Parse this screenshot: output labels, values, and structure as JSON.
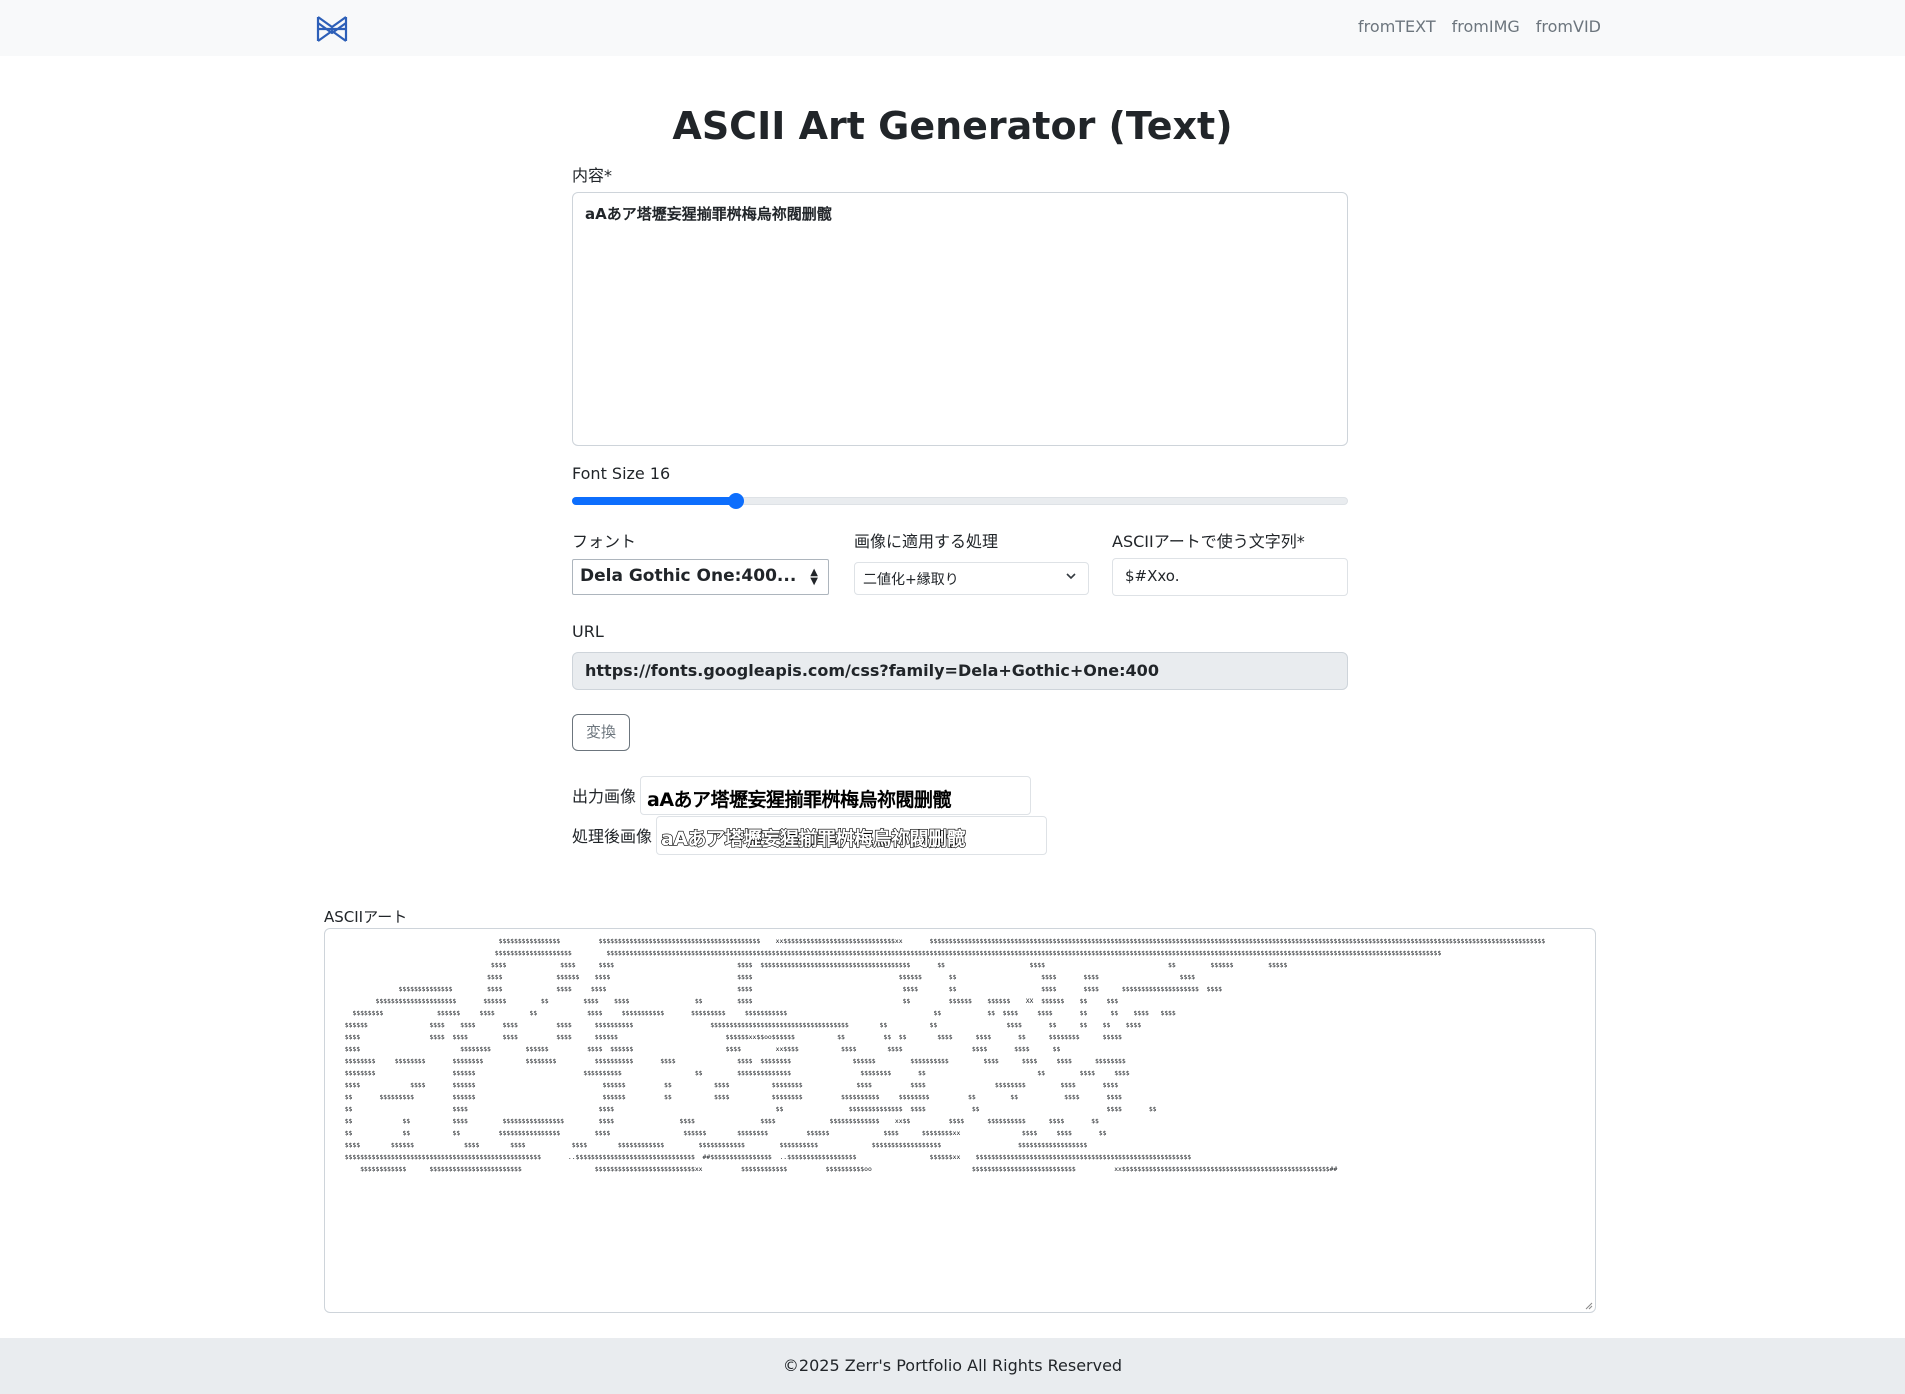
{
  "nav": {
    "logo_icon": "logo-icon",
    "links": [
      "fromTEXT",
      "fromIMG",
      "fromVID"
    ]
  },
  "page": {
    "title": "ASCII Art Generator (Text)"
  },
  "form": {
    "content_label": "内容*",
    "content_value": "aAあア塔壢妄猩揃罪桝梅烏祢閥删髋",
    "font_size_label": "Font Size 16",
    "font_size_value": 16,
    "font_size_min": 1,
    "font_size_max": 72,
    "font_label": "フォント",
    "font_value": "Dela Gothic One:400...",
    "processing_label": "画像に適用する処理",
    "processing_value": "二値化+縁取り",
    "chars_label": "ASCIIアートで使う文字列*",
    "chars_value": "$#Xxo.",
    "url_label": "URL",
    "url_value": "https://fonts.googleapis.com/css?family=Dela+Gothic+One:400",
    "convert_label": "変換"
  },
  "outputs": {
    "output_image_label": "出力画像",
    "output_image_text": "aAあア塔壢妄猩揃罪桝梅烏祢閥删髋",
    "processed_image_label": "処理後画像",
    "processed_image_text": "aAあア塔壢妄猩揃罪桝梅烏祢閥删髋",
    "ascii_label": "ASCIIアート"
  },
  "ascii_art": "                                          $$$$$$$$$$$$$$$$          $$$$$$$$$$$$$$$$$$$$$$$$$$$$$$$$$$$$$$$$$$    xx$$$$$$$$$$$$$$$$$$$$$$$$$$$$$xx       $$$$$$$$$$$$$$$$$$$$$$$$$$$$$$$$$$$$$$$$$$$$$$$$$$$$$$$$$$$$$$$$$$$$$$$$$$$$$$$$$$$$$$$$$$$$$$$$$$$$$$$$$$$$$$$$$$$$$$$$$$$$$$$$$$$$$$$$$$$$$$$$$$$$$$$$$$$$$$$$\n                                         $$$$$$$$$$$$$$$$$$$$         $$$$$$$$$$$$$$$$$$$$$$$$$$$$$$$$$$$$$$$$$$$$$$$$$$$$$$$$$$$$$$$$$$$$$$$$$$$$$$$$$$$$$$$$$$$$$$$$$$$$$$$$$$$$$$$$$$$$$$$$$$$$$$$$$$$$$$$$$$$$$$$$$$$$$$$$$$$$$$$$$$$$$$$$$$$$$$$$$$$$$$$$$$$$$$$$$$$$$$$$$$$$$$$$$$$$$$$$$\n                                        $$$$              $$$$      $$$$                                $$$$  $$$$$$$$$$$$$$$$$$$$$$$$$$$$$$$$$$$$$$$       $$                      $$$$                                $$         $$$$$$         $$$$$\n                                       $$$$              $$$$$$    $$$$                                 $$$$                                      $$$$$$       $$                      $$$$       $$$$                     $$$$\n                $$$$$$$$$$$$$$         $$$$              $$$$     $$$$                                  $$$$                                       $$$$        $$                      $$$$       $$$$      $$$$$$$$$$$$$$$$$$$$  $$$$\n          $$$$$$$$$$$$$$$$$$$$$       $$$$$$         $$         $$$$    $$$$                 $$         $$$$                                       $$          $$$$$$    $$$$$$    XX  $$$$$$    $$     $$$\n    $$$$$$$$              $$$$$$     $$$$         $$             $$$$     $$$$$$$$$$$       $$$$$$$$$     $$$$$$$$$$$                                      $$            $$  $$$$     $$$$       $$      $$    $$$$   $$$$\n  $$$$$$                $$$$    $$$$       $$$$          $$$$      $$$$$$$$$$                    $$$$$$$$$$$$$$$$$$$$$$$$$$$$$$$$$$$$        $$           $$                  $$$$       $$      $$    $$    $$$$\n  $$$$                  $$$$  $$$$         $$$$          $$$$      $$$$$$                            $$$$$$xx$$oo$$$$$$           $$          $$  $$        $$$$      $$$$       $$      $$$$$$$$      $$$$$\n  $$$$                          $$$$$$$$         $$$$$$          $$$$  $$$$$$                        $$$$         xx$$$$           $$$$        $$$$                  $$$$       $$$$      $$\n  $$$$$$$$     $$$$$$$$       $$$$$$$$           $$$$$$$$          $$$$$$$$$$       $$$$                $$$$  $$$$$$$$                $$$$$$         $$$$$$$$$$         $$$$      $$$$     $$$$      $$$$$$$$\n  $$$$$$$$                    $$$$$$                            $$$$$$$$$$                   $$         $$$$$$$$$$$$$$                  $$$$$$$$       $$                             $$         $$$$     $$$$\n  $$$$             $$$$       $$$$$$                                 $$$$$$          $$           $$$$           $$$$$$$$              $$$$          $$$$                  $$$$$$$$         $$$$       $$$$\n  $$       $$$$$$$$$          $$$$$$                                 $$$$$$          $$           $$$$           $$$$$$$$          $$$$$$$$$$     $$$$$$$$          $$         $$            $$$$       $$$$\n  $$                          $$$$                                  $$$$                                          $$                 $$$$$$$$$$$$$$  $$$$            $$                                 $$$$       $$\n  $$             $$           $$$$         $$$$$$$$$$$$$$$$         $$$$                 $$$$                 $$$$              $$$$$$$$$$$$$    xx$$          $$$$      $$$$$$$$$$      $$$$       $$\n  $$             $$           $$          $$$$$$$$$$$$$$$$         $$$$                   $$$$$$        $$$$$$$$          $$$$$$              $$$$      $$$$$$$$xx                $$$$     $$$$       $$\n  $$$$        $$$$$$             $$$$        $$$$            $$$$        $$$$$$$$$$$$         $$$$$$$$$$$$         $$$$$$$$$$              $$$$$$$$$$$$$$$$$$                    $$$$$$$$$$$$$$$$$$\n  $$$$$$$$$$$$$$$$$$$$$$$$$$$$$$$$$$$$$$$$$$$$$$$$$$$       ..$$$$$$$$$$$$$$$$$$$$$$$$$$$$$$$  ##$$$$$$$$$$$$$$$$  ..$$$$$$$$$$$$$$$$$$                   $$$$$$xx    $$$$$$$$$$$$$$$$$$$$$$$$$$$$$$$$$$$$$$$$$$$$$$$$$$$$$$$$\n      $$$$$$$$$$$$      $$$$$$$$$$$$$$$$$$$$$$$$                   $$$$$$$$$$$$$$$$$$$$$$$$$$xx          $$$$$$$$$$$$          $$$$$$$$$$oo                          $$$$$$$$$$$$$$$$$$$$$$$$$$$          xx$$$$$$$$$$$$$$$$$$$$$$$$$$$$$$$$$$$$$$$$$$$$$$$$$$$$$$##"
}
